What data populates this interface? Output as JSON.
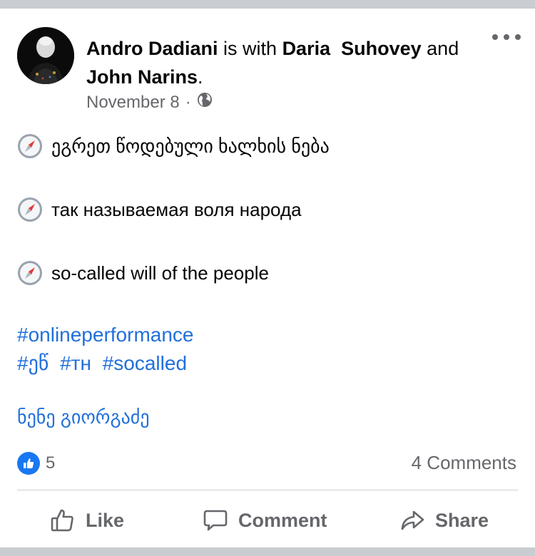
{
  "post": {
    "author": "Andro Dadiani",
    "with_text": "is with",
    "tagged_1": "Daria  Suhovey",
    "and_text": "and",
    "tagged_2": "John Narins",
    "period": ".",
    "date": "November 8",
    "separator": "·",
    "privacy_icon": "globe-icon",
    "menu_icon": "more-dots-icon"
  },
  "body": {
    "line_icon": "compass-emoji",
    "lines": [
      "ეგრეთ წოდებული ხალხის ნება",
      "так называемая воля народа",
      "so-called will of the people"
    ],
    "hashtags_line1": [
      "#onlineperformance"
    ],
    "hashtags_line2": [
      "#ეწ",
      "#тн",
      "#socalled"
    ],
    "author_tag": "ნენე გიორგაძე"
  },
  "stats": {
    "reaction_icon": "like-reaction-icon",
    "reaction_count": "5",
    "comments": "4 Comments"
  },
  "actions": {
    "like": "Like",
    "comment": "Comment",
    "share": "Share"
  },
  "colors": {
    "link": "#216fdb",
    "secondary_text": "#65676b",
    "like_blue": "#1877f2",
    "frame": "#c9ccd1"
  }
}
